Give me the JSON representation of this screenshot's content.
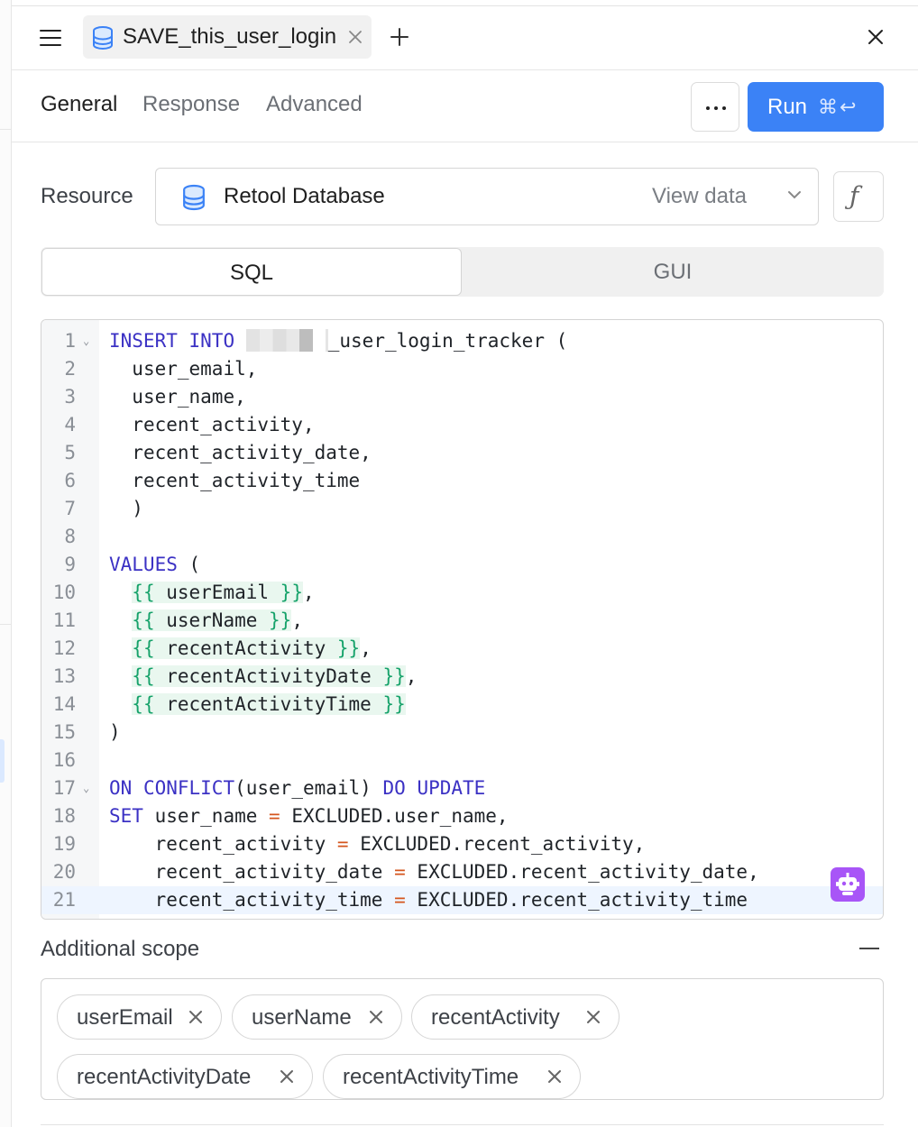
{
  "tab": {
    "title": "SAVE_this_user_login"
  },
  "subtabs": [
    "General",
    "Response",
    "Advanced"
  ],
  "toolbar": {
    "more_label": "more",
    "run_label": "Run",
    "run_shortcut": "⌘↩"
  },
  "resource": {
    "label": "Resource",
    "name": "Retool Database",
    "view_data": "View data",
    "function_glyph": "ƒ"
  },
  "mode": {
    "options": [
      "SQL",
      "GUI"
    ],
    "selected": "SQL"
  },
  "editor": {
    "line_numbers": [
      "1",
      "2",
      "3",
      "4",
      "5",
      "6",
      "7",
      "8",
      "9",
      "10",
      "11",
      "12",
      "13",
      "14",
      "15",
      "16",
      "17",
      "18",
      "19",
      "20",
      "21"
    ],
    "table_suffix": "_user_login_tracker (",
    "columns": [
      "user_email,",
      "user_name,",
      "recent_activity,",
      "recent_activity_date,",
      "recent_activity_time"
    ],
    "close_paren_indent": ")",
    "values_kw": "VALUES",
    "open_paren": " (",
    "template_vars": [
      "userEmail",
      "userName",
      "recentActivity",
      "recentActivityDate",
      "recentActivityTime"
    ],
    "close_paren": ")",
    "kw": {
      "insert": "INSERT",
      "into": "INTO",
      "on": "ON",
      "conflict": "CONFLICT",
      "do": "DO",
      "update": "UPDATE",
      "set": "SET"
    },
    "conflict_arg": "(user_email)",
    "set_lines": [
      {
        "lhs": "user_name",
        "rhs": "EXCLUDED.user_name,"
      },
      {
        "lhs": "recent_activity",
        "rhs": "EXCLUDED.recent_activity,"
      },
      {
        "lhs": "recent_activity_date",
        "rhs": "EXCLUDED.recent_activity_date,"
      },
      {
        "lhs": "recent_activity_time",
        "rhs": "EXCLUDED.recent_activity_time"
      }
    ]
  },
  "scope": {
    "label": "Additional scope",
    "chips": [
      "userEmail",
      "userName",
      "recentActivity",
      "recentActivityDate",
      "recentActivityTime"
    ]
  }
}
